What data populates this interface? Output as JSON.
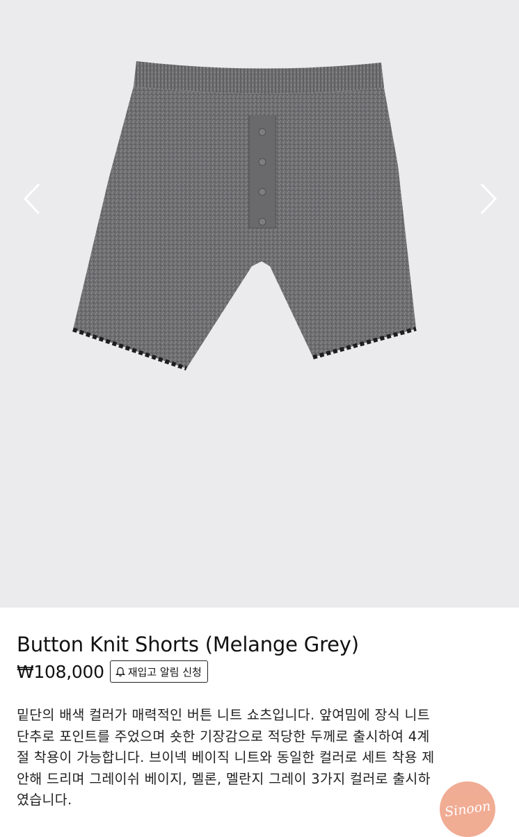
{
  "gallery": {
    "image_alt": "Button Knit Shorts (Melange Grey)",
    "prev_icon": "chevron-left-icon",
    "next_icon": "chevron-right-icon",
    "background": "#ebebed"
  },
  "product": {
    "title": "Button Knit Shorts (Melange Grey)",
    "price": "₩108,000",
    "restock_label": "재입고 알림 신청",
    "restock_icon": "bell-icon",
    "description_lines": [
      "밑단의 배색 컬러가 매력적인 버튼 니트 쇼츠입니다. 앞여밈에 장식 니트",
      "단추로 포인트를 주었으며 숏한 기장감으로 적당한 두께로 출시하여 4계",
      "절 착용이 가능합니다. 브이넥 베이직 니트와 동일한 컬러로 세트 착용 제",
      "안해 드리며 그레이쉬 베이지, 멜론, 멜란지 그레이 3가지 컬러로 출시하",
      "였습니다."
    ]
  },
  "badge": {
    "label": "Sinoon",
    "color": "#f0a58c"
  }
}
